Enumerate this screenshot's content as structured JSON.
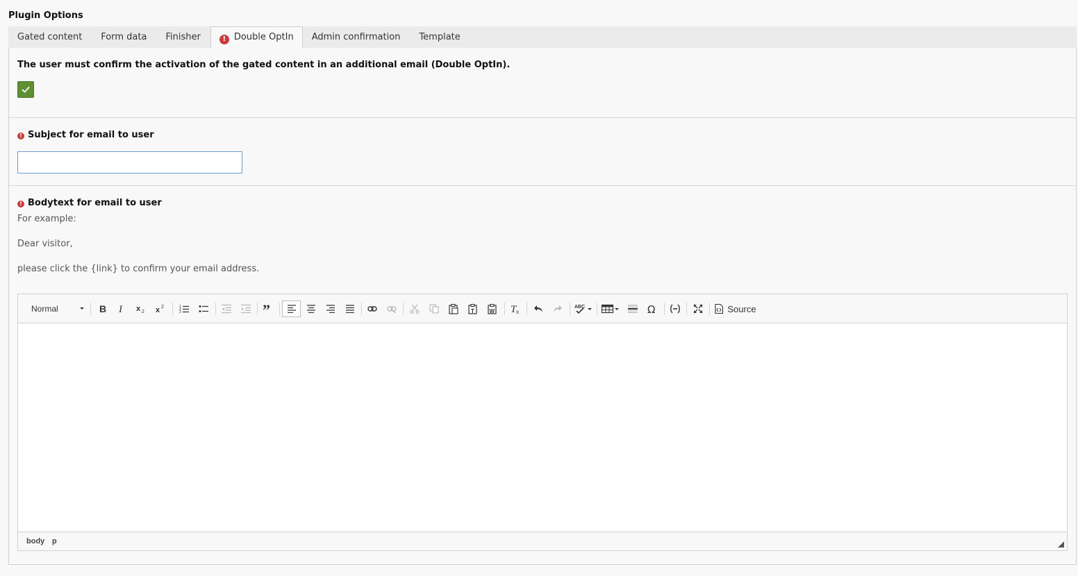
{
  "section_title": "Plugin Options",
  "tabs": [
    {
      "label": "Gated content",
      "active": false,
      "error": false
    },
    {
      "label": "Form data",
      "active": false,
      "error": false
    },
    {
      "label": "Finisher",
      "active": false,
      "error": false
    },
    {
      "label": "Double OptIn",
      "active": true,
      "error": true
    },
    {
      "label": "Admin confirmation",
      "active": false,
      "error": false
    },
    {
      "label": "Template",
      "active": false,
      "error": false
    }
  ],
  "fields": {
    "double_optin": {
      "label": "The user must confirm the activation of the gated content in an additional email (Double OptIn).",
      "checked": true
    },
    "subject": {
      "label": "Subject for email to user",
      "value": "",
      "required_error": true
    },
    "bodytext": {
      "label": "Bodytext for email to user",
      "required_error": true,
      "description_lines": [
        "For example:",
        "Dear visitor,",
        "please click the {link} to confirm your email address."
      ]
    }
  },
  "editor": {
    "format_select": "Normal",
    "toolbar": [
      "bold-icon",
      "italic-icon",
      "subscript-icon",
      "superscript-icon",
      "numbered-list-icon",
      "bulleted-list-icon",
      "decrease-indent-icon",
      "increase-indent-icon",
      "blockquote-icon",
      "align-left-icon",
      "align-center-icon",
      "align-right-icon",
      "justify-icon",
      "link-icon",
      "unlink-icon",
      "cut-icon",
      "copy-icon",
      "paste-icon",
      "paste-text-icon",
      "paste-word-icon",
      "remove-format-icon",
      "undo-icon",
      "redo-icon",
      "spellcheck-icon",
      "table-icon",
      "horizontal-line-icon",
      "special-char-icon",
      "soft-hyphen-icon",
      "maximize-icon"
    ],
    "source_label": "Source",
    "statusbar_path": [
      "body",
      "p"
    ]
  },
  "colors": {
    "checkbox_green": "#5e8f32",
    "error_red": "#c83c3c",
    "input_focus_border": "#6a99cc"
  }
}
